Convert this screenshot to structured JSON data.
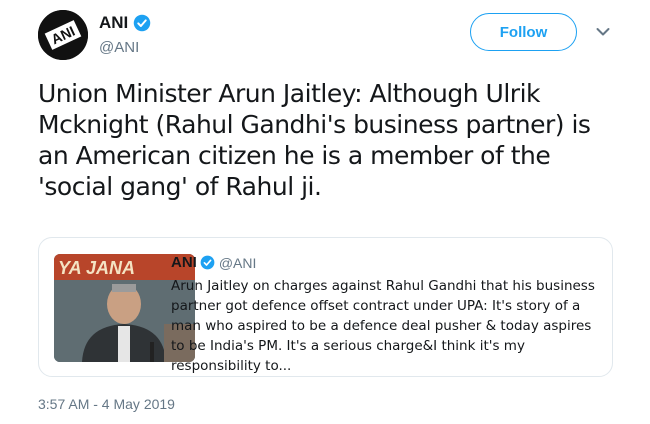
{
  "author": {
    "name": "ANI",
    "handle": "@ANI",
    "avatar_text": "ANI",
    "verified": true
  },
  "follow_button_label": "Follow",
  "tweet_text": "Union Minister Arun Jaitley: Although Ulrik Mcknight (Rahul Gandhi's business partner) is an American citizen he is a member of the 'social gang' of Rahul ji.",
  "quoted_tweet": {
    "name": "ANI",
    "handle": "@ANI",
    "verified": true,
    "image_text": "YA JANA",
    "text": "Arun Jaitley on charges against Rahul Gandhi that his business partner got defence offset contract under UPA: It's story of a man who aspired to be a defence deal pusher & today aspires to be India's PM. It's a serious charge&I think it's my responsibility to..."
  },
  "timestamp": "3:57 AM - 4 May 2019",
  "colors": {
    "accent": "#1da1f2",
    "text": "#14171a",
    "muted": "#657786",
    "border": "#e1e8ed"
  },
  "icons": {
    "verified": "verified-badge-icon",
    "caret": "chevron-down-icon"
  }
}
